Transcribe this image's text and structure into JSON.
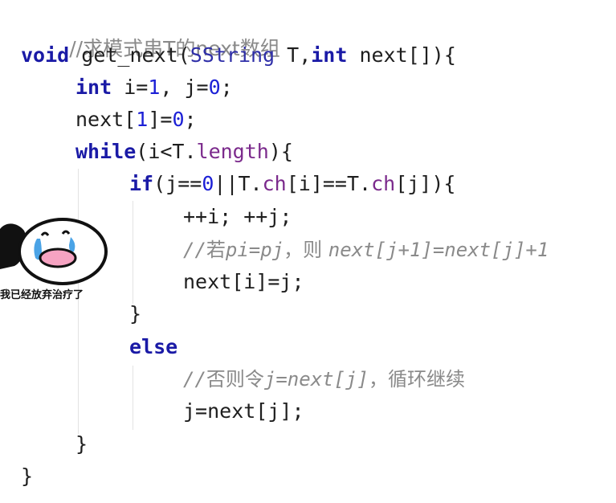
{
  "code": {
    "comment_header": "//求模式串T的next数组",
    "line1": {
      "kw_void": "void",
      "fn": " get_next(",
      "type": "SString",
      "mid": " T,",
      "kw_int": "int",
      "rest": " next[]){"
    },
    "line2": {
      "kw": "int",
      "a": " i=",
      "n1": "1",
      "b": ", j=",
      "n0": "0",
      "c": ";"
    },
    "line3": {
      "a": "next[",
      "n1": "1",
      "b": "]=",
      "n0": "0",
      "c": ";"
    },
    "line4": {
      "kw": "while",
      "a": "(i<T.",
      "field": "length",
      "b": "){"
    },
    "line5": {
      "kw": "if",
      "a": "(j==",
      "n0": "0",
      "b": "||T.",
      "f1": "ch",
      "c": "[i]==T.",
      "f2": "ch",
      "d": "[j]){"
    },
    "line6": "++i; ++j;",
    "line7": {
      "slashes": "//",
      "cn1": "若",
      "m1": "pi=pj",
      "cn2": "，则 ",
      "m2": "next[j+1]=next[j]+1"
    },
    "line8": "next[i]=j;",
    "line9": "}",
    "line10": {
      "kw": "else"
    },
    "line11": {
      "slashes": "//",
      "cn1": "否则令",
      "m1": "j=next[j]",
      "cn2": "，循环继续"
    },
    "line12": "j=next[j];",
    "line13": "}",
    "line14": "}"
  },
  "sticker": {
    "caption": "我已经放弃治疗了"
  }
}
